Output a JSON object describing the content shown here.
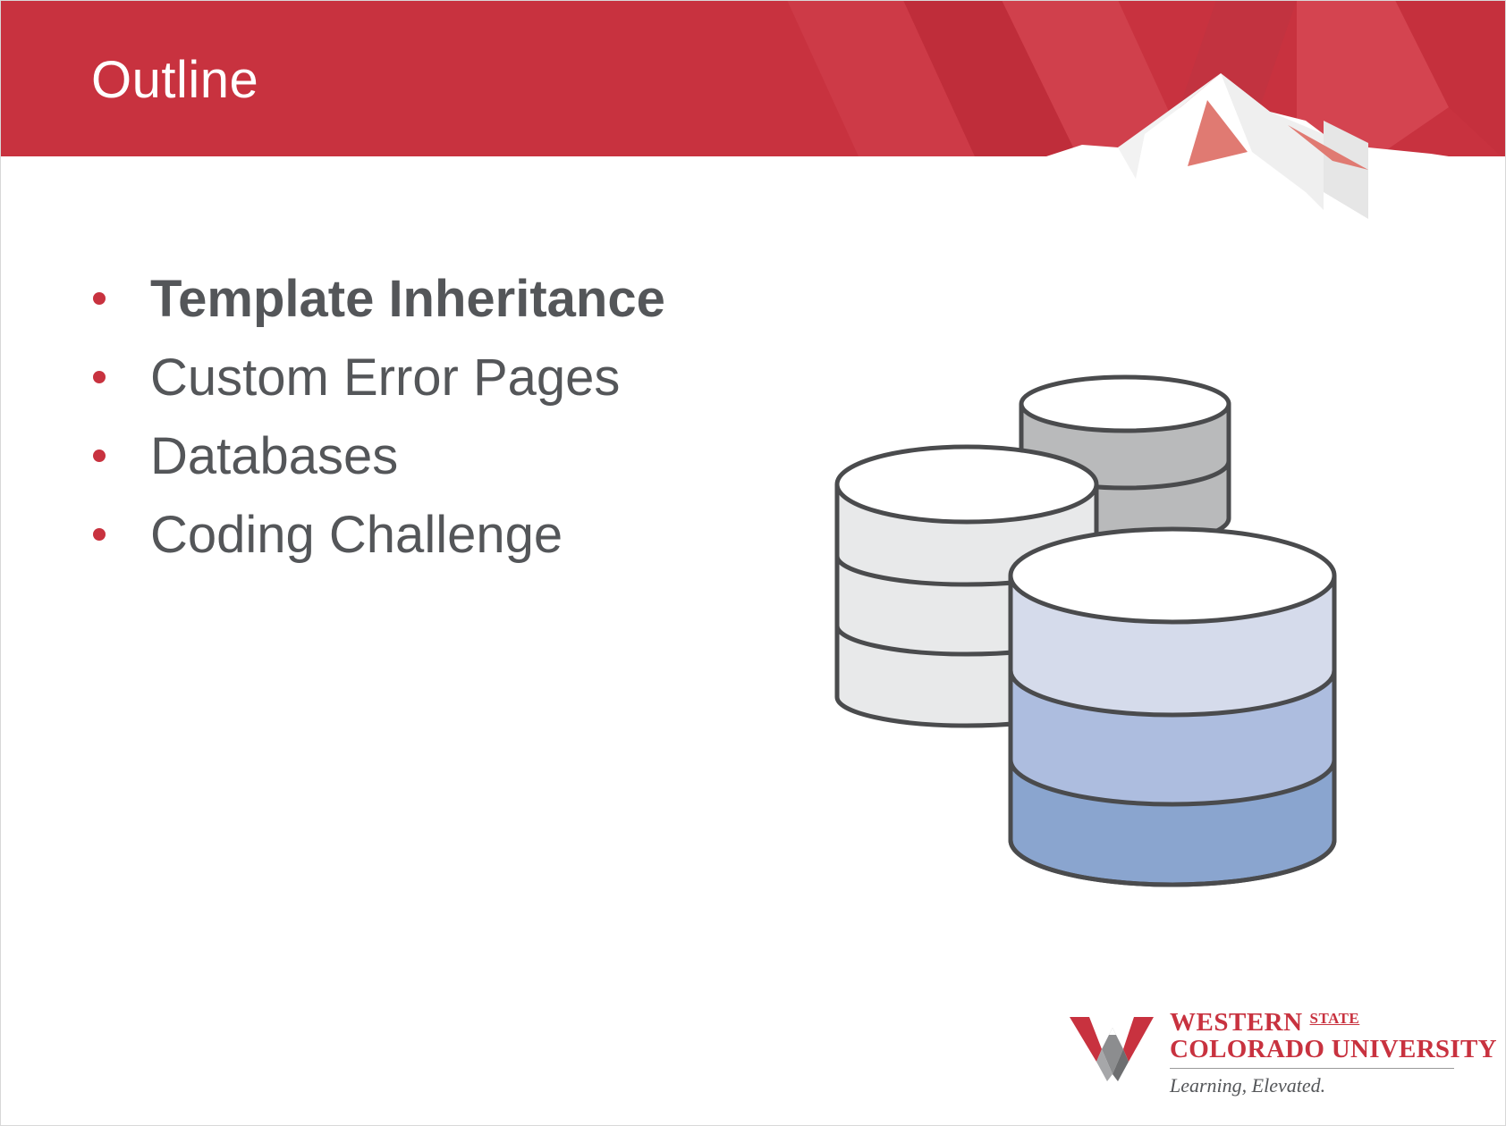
{
  "slide": {
    "title": "Outline",
    "bullets": [
      {
        "label": "Template Inheritance",
        "emphasis": "bold"
      },
      {
        "label": "Custom Error Pages",
        "emphasis": "normal"
      },
      {
        "label": "Databases",
        "emphasis": "normal"
      },
      {
        "label": "Coding Challenge",
        "emphasis": "normal"
      }
    ],
    "illustration": "database-stack-icon"
  },
  "logo": {
    "line1": "WESTERN",
    "state": "STATE",
    "line2": "COLORADO UNIVERSITY",
    "tagline": "Learning, Elevated."
  },
  "colors": {
    "brand_red": "#c8323f",
    "text_gray": "#545659",
    "db_light": "#e8e9ea",
    "db_gray": "#b9babb",
    "db_blue_1": "#d5dbeb",
    "db_blue_2": "#adbddf",
    "db_blue_3": "#8aa5cf"
  }
}
